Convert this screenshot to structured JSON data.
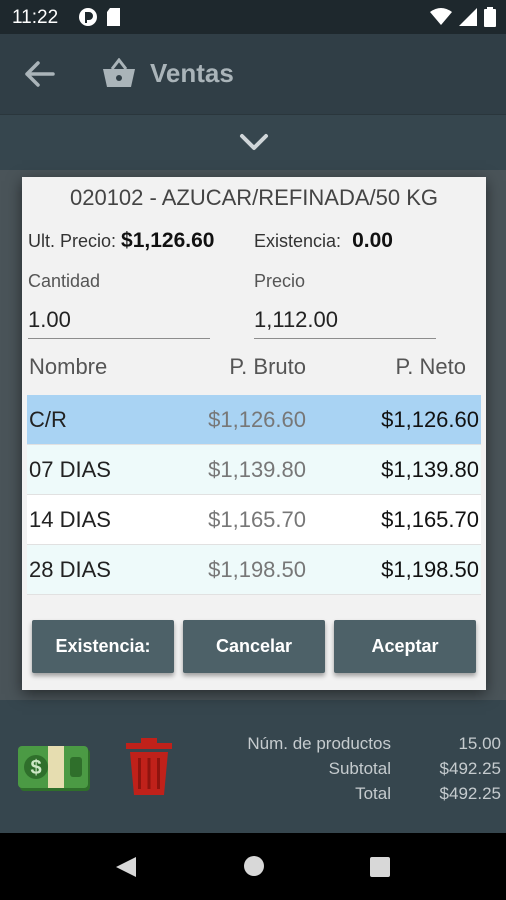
{
  "status_bar": {
    "time": "11:22"
  },
  "app_bar": {
    "title": "Ventas"
  },
  "dialog": {
    "title": "020102 - AZUCAR/REFINADA/50 KG",
    "ult_precio_label": "Ult. Precio:",
    "ult_precio_value": "$1,126.60",
    "existencia_label": "Existencia:",
    "existencia_value": "0.00",
    "cantidad_label": "Cantidad",
    "cantidad_value": "1.00",
    "precio_label": "Precio",
    "precio_value": "1,112.00",
    "columns": [
      "Nombre",
      "P. Bruto",
      "P. Neto"
    ],
    "rows": [
      {
        "nombre": "C/R",
        "bruto": "$1,126.60",
        "neto": "$1,126.60",
        "bg": "#a9d3f3"
      },
      {
        "nombre": "07 DIAS",
        "bruto": "$1,139.80",
        "neto": "$1,139.80",
        "bg": "#eefafa"
      },
      {
        "nombre": "14 DIAS",
        "bruto": "$1,165.70",
        "neto": "$1,165.70",
        "bg": "#ffffff"
      },
      {
        "nombre": "28 DIAS",
        "bruto": "$1,198.50",
        "neto": "$1,198.50",
        "bg": "#eefafa"
      }
    ],
    "buttons": {
      "existencia": "Existencia:",
      "cancelar": "Cancelar",
      "aceptar": "Aceptar"
    }
  },
  "footer": {
    "num_productos_label": "Núm. de productos",
    "num_productos_value": "15.00",
    "subtotal_label": "Subtotal",
    "subtotal_value": "$492.25",
    "total_label": "Total",
    "total_value": "$492.25"
  },
  "colors": {
    "app_bar": "#303e46",
    "button": "#4d6168",
    "selected_row": "#a9d3f3",
    "trash": "#c0211a",
    "cash": "#3f8a3a"
  }
}
